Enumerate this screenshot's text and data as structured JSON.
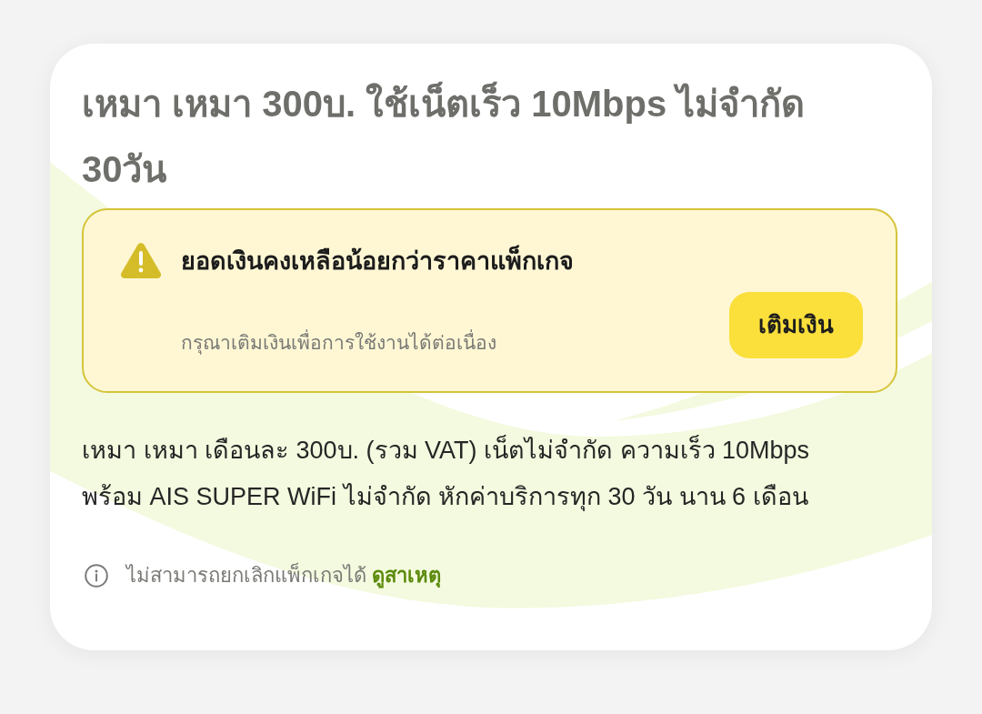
{
  "card": {
    "title": "เหมา เหมา 300บ. ใช้เน็ตเร็ว 10Mbps ไม่จำกัด 30วัน"
  },
  "alert": {
    "kind": "warning",
    "heading": "ยอดเงินคงเหลือน้อยกว่าราคาแพ็กเกจ",
    "message": "กรุณาเติมเงินเพื่อการใช้งานได้ต่อเนื่อง",
    "button": "เติมเงิน"
  },
  "description": "เหมา เหมา เดือนละ 300บ. (รวม VAT) เน็ตไม่จำกัด ความเร็ว 10Mbps พร้อม AIS SUPER WiFi ไม่จำกัด หักค่าบริการทุก 30 วัน นาน 6 เดือน",
  "note": {
    "text": "ไม่สามารถยกเลิกแพ็กเกจได้",
    "link": "ดูสาเหตุ"
  }
}
